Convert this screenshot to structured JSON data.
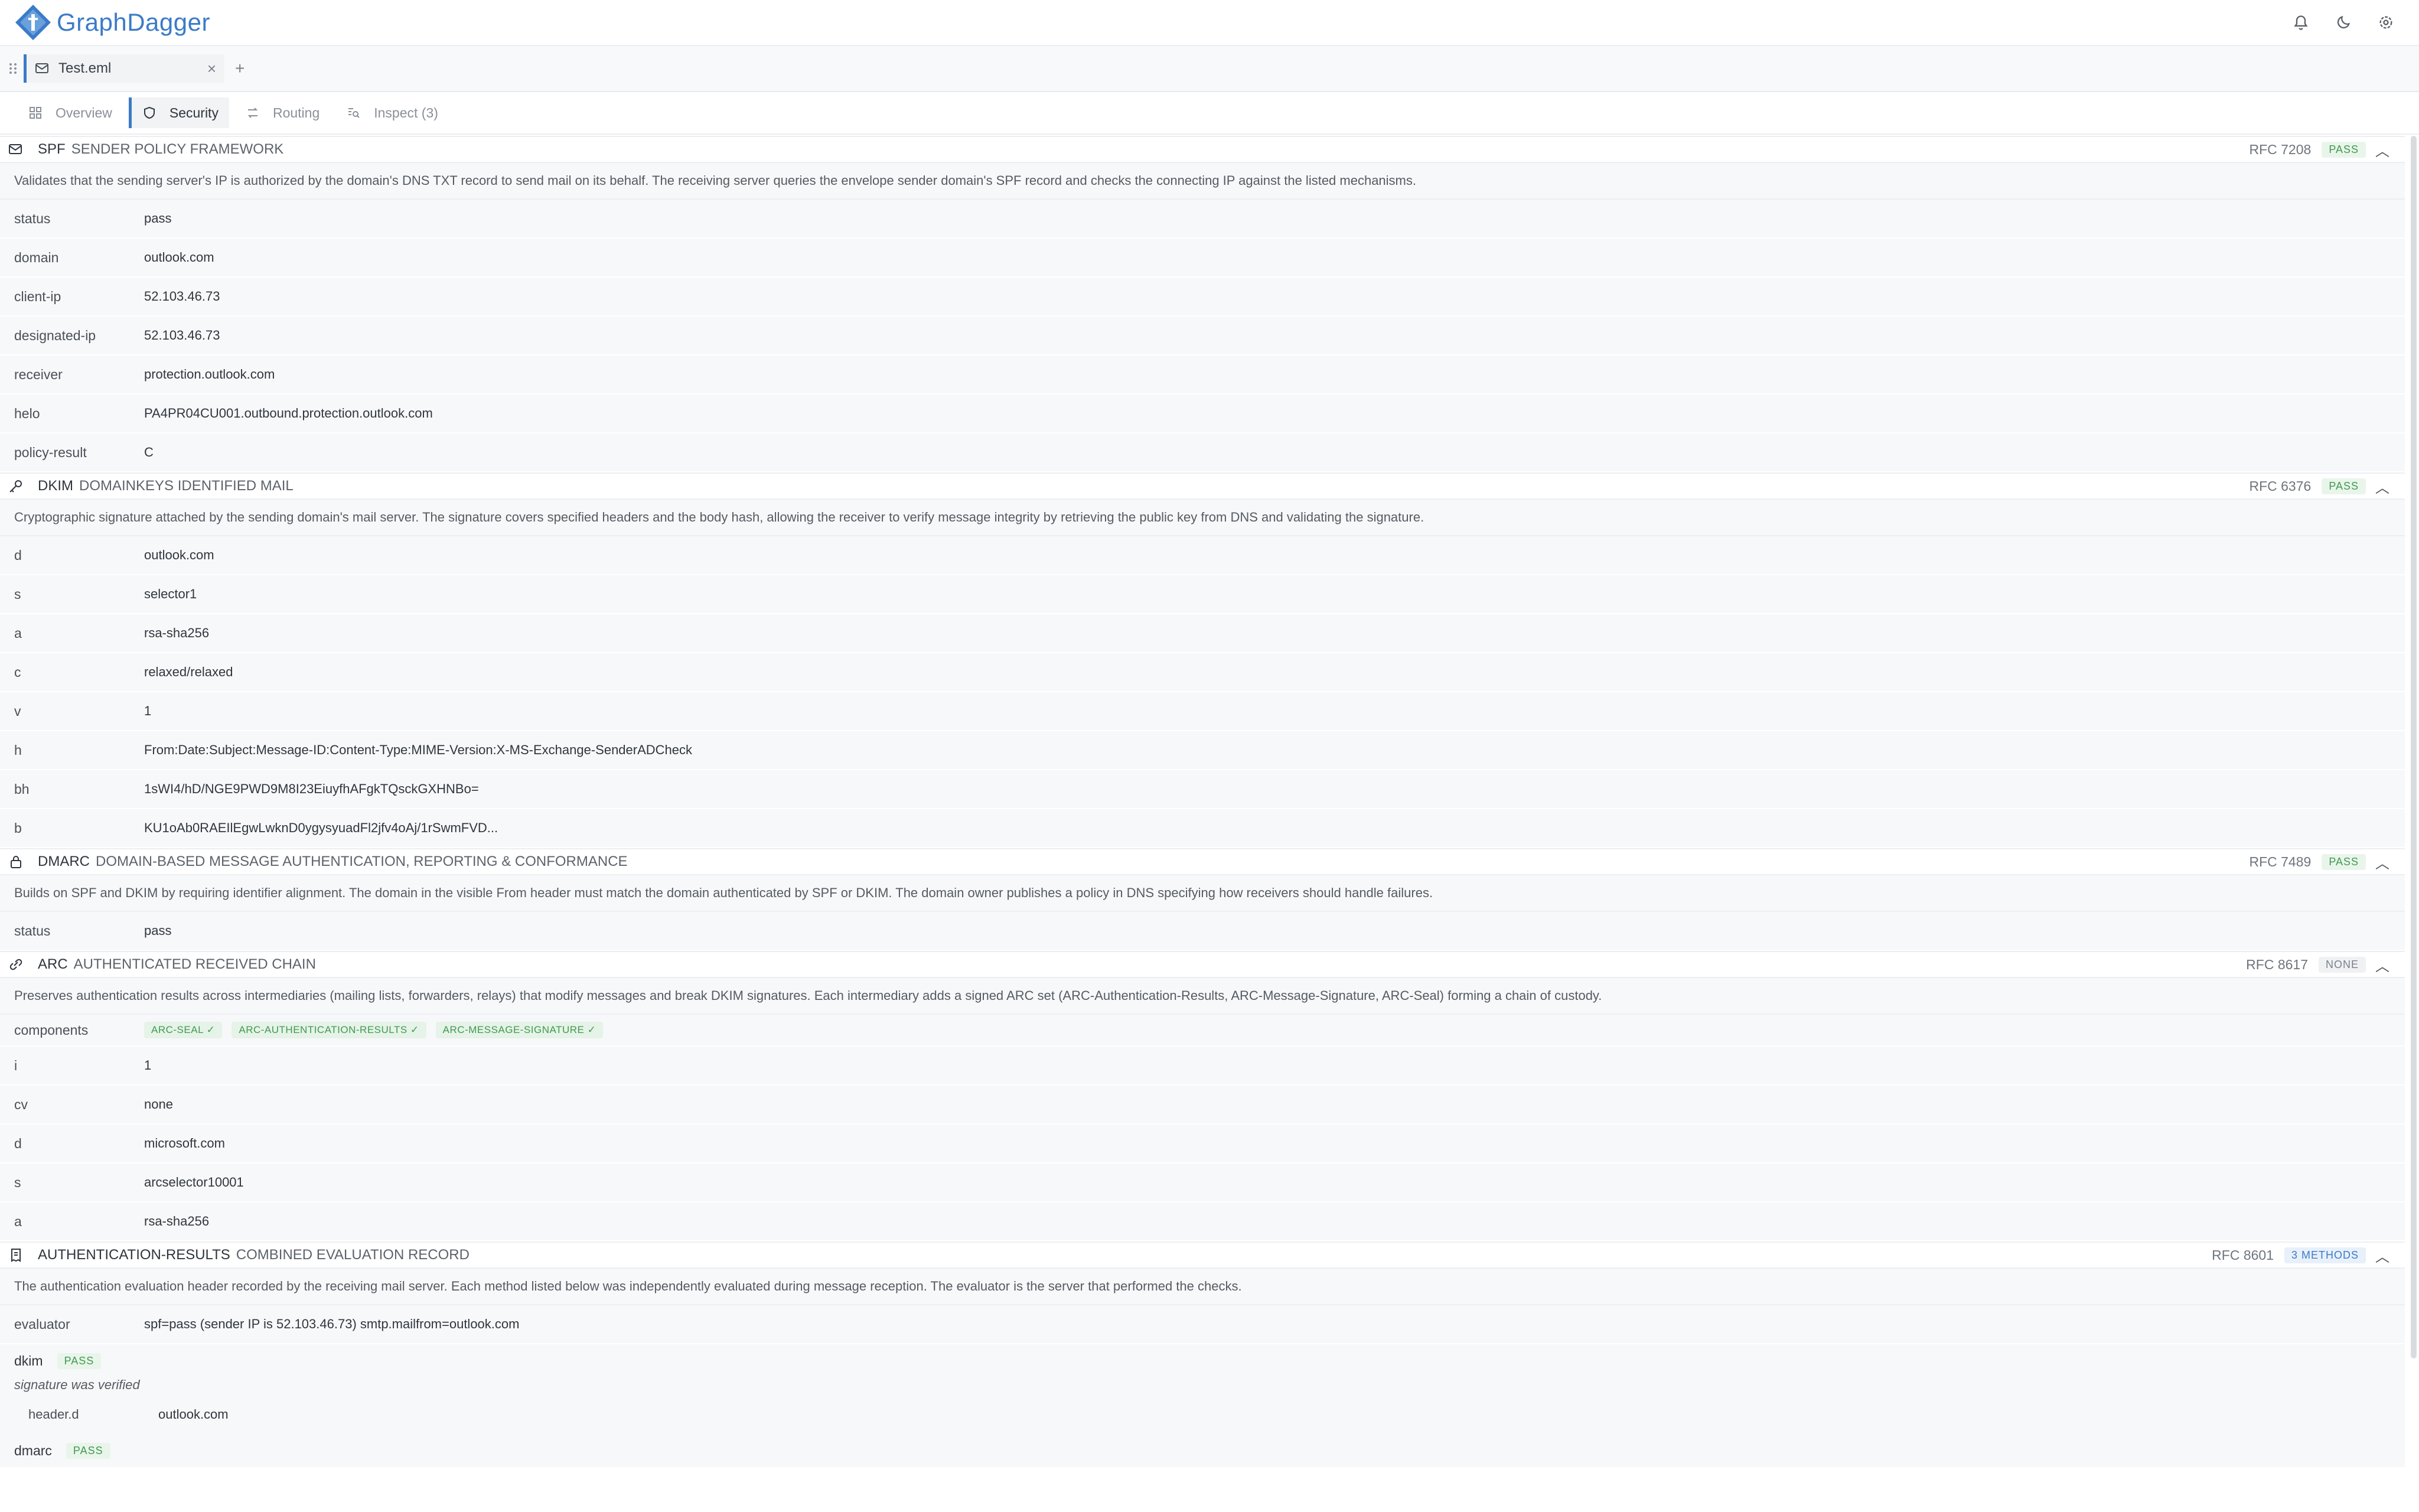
{
  "app": {
    "name": "GraphDagger"
  },
  "file_tabs": [
    {
      "label": "Test.eml",
      "close": "×"
    }
  ],
  "add_tab": "+",
  "view_tabs": [
    {
      "label": "Overview",
      "icon": "overview-icon"
    },
    {
      "label": "Security",
      "icon": "shield-icon",
      "active": true
    },
    {
      "label": "Routing",
      "icon": "routing-icon"
    },
    {
      "label": "Inspect (3)",
      "icon": "inspect-icon"
    }
  ],
  "colors": {
    "accent": "#3b7bc8",
    "pass": "#3f9a4e"
  },
  "sections": {
    "spf": {
      "abbr": "SPF",
      "full": "Sender Policy Framework",
      "rfc": "RFC 7208",
      "badge": "PASS",
      "description": "Validates that the sending server's IP is authorized by the domain's DNS TXT record to send mail on its behalf. The receiving server queries the envelope sender domain's SPF record and checks the connecting IP against the listed mechanisms.",
      "rows": [
        {
          "key": "status",
          "value": "pass"
        },
        {
          "key": "domain",
          "value": "outlook.com"
        },
        {
          "key": "client-ip",
          "value": "52.103.46.73"
        },
        {
          "key": "designated-ip",
          "value": "52.103.46.73"
        },
        {
          "key": "receiver",
          "value": "protection.outlook.com"
        },
        {
          "key": "helo",
          "value": "PA4PR04CU001.outbound.protection.outlook.com"
        },
        {
          "key": "policy-result",
          "value": "C"
        }
      ]
    },
    "dkim": {
      "abbr": "DKIM",
      "full": "DomainKeys Identified Mail",
      "rfc": "RFC 6376",
      "badge": "PASS",
      "description": "Cryptographic signature attached by the sending domain's mail server. The signature covers specified headers and the body hash, allowing the receiver to verify message integrity by retrieving the public key from DNS and validating the signature.",
      "rows": [
        {
          "key": "d",
          "value": "outlook.com"
        },
        {
          "key": "s",
          "value": "selector1"
        },
        {
          "key": "a",
          "value": "rsa-sha256"
        },
        {
          "key": "c",
          "value": "relaxed/relaxed"
        },
        {
          "key": "v",
          "value": "1"
        },
        {
          "key": "h",
          "value": "From:Date:Subject:Message-ID:Content-Type:MIME-Version:X-MS-Exchange-SenderADCheck"
        },
        {
          "key": "bh",
          "value": "1sWI4/hD/NGE9PWD9M8I23EiuyfhAFgkTQsckGXHNBo="
        },
        {
          "key": "b",
          "value": "KU1oAb0RAEIlEgwLwknD0ygysyuadFl2jfv4oAj/1rSwmFVD..."
        }
      ]
    },
    "dmarc": {
      "abbr": "DMARC",
      "full": "Domain-based Message Authentication, Reporting & Conformance",
      "rfc": "RFC 7489",
      "badge": "PASS",
      "description": "Builds on SPF and DKIM by requiring identifier alignment. The domain in the visible From header must match the domain authenticated by SPF or DKIM. The domain owner publishes a policy in DNS specifying how receivers should handle failures.",
      "rows": [
        {
          "key": "status",
          "value": "pass"
        }
      ]
    },
    "arc": {
      "abbr": "ARC",
      "full": "Authenticated Received Chain",
      "rfc": "RFC 8617",
      "badge": "NONE",
      "description": "Preserves authentication results across intermediaries (mailing lists, forwarders, relays) that modify messages and break DKIM signatures. Each intermediary adds a signed ARC set (ARC-Authentication-Results, ARC-Message-Signature, ARC-Seal) forming a chain of custody.",
      "components_label": "components",
      "components": [
        "ARC-SEAL ✓",
        "ARC-AUTHENTICATION-RESULTS ✓",
        "ARC-MESSAGE-SIGNATURE ✓"
      ],
      "rows": [
        {
          "key": "i",
          "value": "1"
        },
        {
          "key": "cv",
          "value": "none"
        },
        {
          "key": "d",
          "value": "microsoft.com"
        },
        {
          "key": "s",
          "value": "arcselector10001"
        },
        {
          "key": "a",
          "value": "rsa-sha256"
        }
      ]
    },
    "auth": {
      "abbr": "AUTHENTICATION-RESULTS",
      "full": "Combined Evaluation Record",
      "rfc": "RFC 8601",
      "badge": "3 METHODS",
      "description": "The authentication evaluation header recorded by the receiving mail server. Each method listed below was independently evaluated during message reception. The evaluator is the server that performed the checks.",
      "evaluator_key": "evaluator",
      "evaluator_value": "spf=pass (sender IP is 52.103.46.73) smtp.mailfrom=outlook.com",
      "methods": [
        {
          "name": "dkim",
          "badge": "PASS",
          "note": "signature was verified",
          "sub_key": "header.d",
          "sub_value": "outlook.com"
        },
        {
          "name": "dmarc",
          "badge": "PASS"
        }
      ]
    }
  }
}
